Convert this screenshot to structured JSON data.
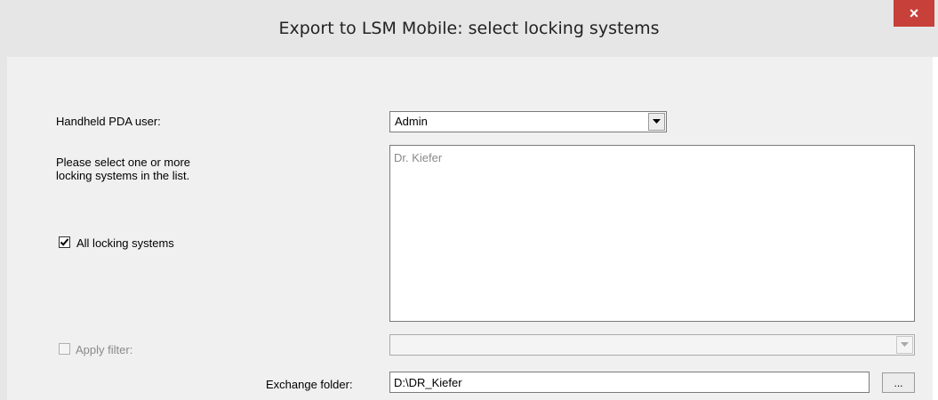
{
  "window": {
    "title": "Export to LSM Mobile: select locking systems",
    "close_glyph": "×",
    "accent_close": "#c7403a"
  },
  "form": {
    "pda_user_label": "Handheld PDA user:",
    "pda_user_value": "Admin",
    "instruction_line1": "Please select one or more",
    "instruction_line2": "locking systems in the list.",
    "locking_systems": [
      "Dr. Kiefer"
    ],
    "all_locking_systems_label": "All locking systems",
    "all_locking_systems_checked": true,
    "apply_filter_label": "Apply filter:",
    "apply_filter_checked": false,
    "apply_filter_enabled": false,
    "filter_value": "",
    "exchange_folder_label": "Exchange folder:",
    "exchange_folder_value": "D:\\DR_Kiefer",
    "browse_label": "..."
  },
  "icons": {
    "combo_arrow": "chevron-down-icon",
    "close": "close-icon",
    "check": "checkmark-icon"
  }
}
